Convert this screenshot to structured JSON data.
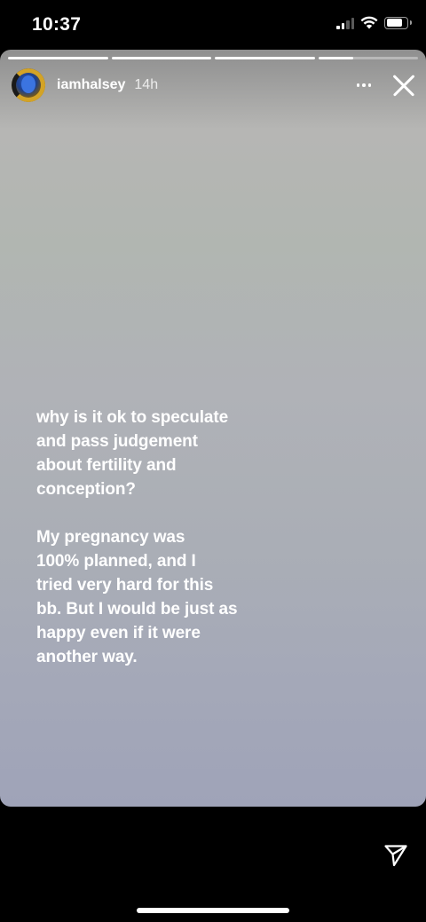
{
  "status_bar": {
    "time": "10:37",
    "battery_level": 0.8,
    "signal_bars": 2
  },
  "story": {
    "progress": [
      1,
      1,
      1,
      0.35
    ],
    "user": {
      "username": "iamhalsey",
      "time_ago": "14h",
      "avatar_icon": "profile-avatar"
    },
    "paragraphs": [
      "why is it ok to speculate\nand pass judgement\nabout fertility and\nconception?",
      "My pregnancy was\n100% planned, and I\ntried very hard for this\nbb. But I would be just as\nhappy even if it were\nanother way."
    ],
    "icons": {
      "more": "more-options-icon",
      "close": "close-icon"
    }
  },
  "bottom": {
    "send_icon": "direct-send-icon"
  }
}
